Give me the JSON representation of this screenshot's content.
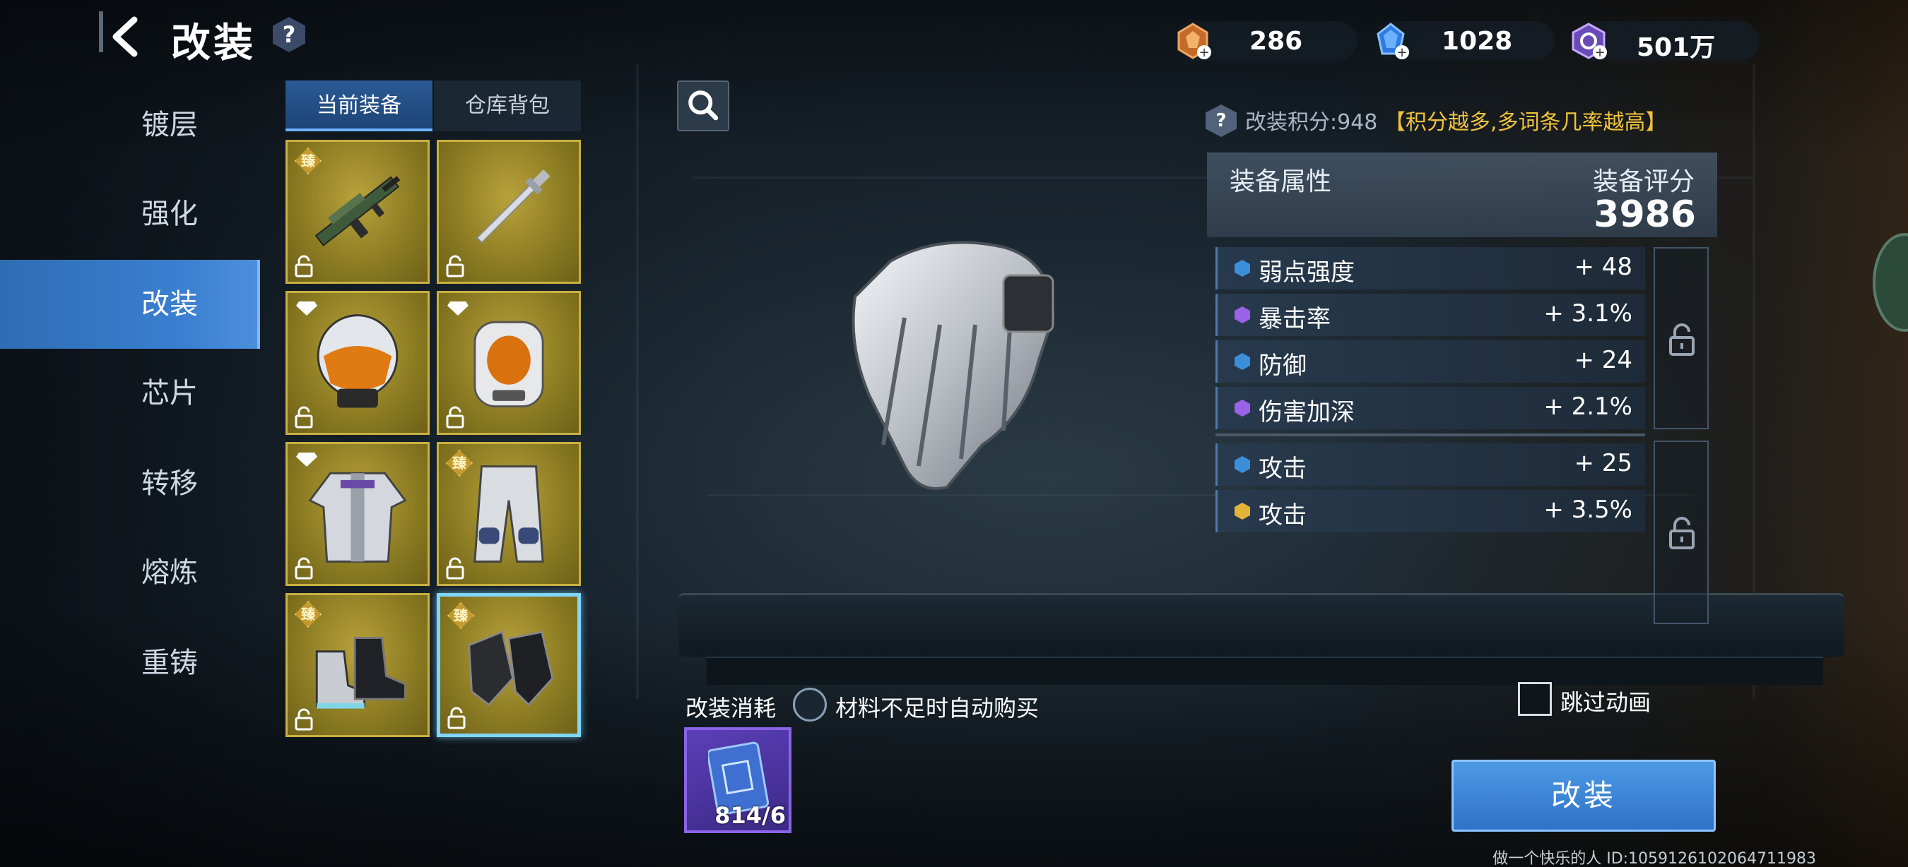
{
  "header": {
    "title": "改装",
    "help": "?"
  },
  "currencies": [
    {
      "name": "fuel",
      "value": "286",
      "color": "#d9823a"
    },
    {
      "name": "diamond",
      "value": "1028",
      "color": "#2f7be0"
    },
    {
      "name": "coin",
      "value": "501万",
      "color": "#8a5fd6"
    }
  ],
  "sidebar": {
    "items": [
      {
        "label": "镀层",
        "active": false
      },
      {
        "label": "强化",
        "active": false
      },
      {
        "label": "改装",
        "active": true
      },
      {
        "label": "芯片",
        "active": false
      },
      {
        "label": "转移",
        "active": false
      },
      {
        "label": "熔炼",
        "active": false
      },
      {
        "label": "重铸",
        "active": false
      }
    ]
  },
  "tabs": [
    {
      "label": "当前装备",
      "active": true
    },
    {
      "label": "仓库背包",
      "active": false
    }
  ],
  "equipment": [
    {
      "item": "rifle",
      "badge": "臻",
      "selected": false
    },
    {
      "item": "sword",
      "badge": "",
      "selected": false
    },
    {
      "item": "helmet",
      "badge": "gem",
      "selected": false
    },
    {
      "item": "backpack",
      "badge": "gem",
      "selected": false
    },
    {
      "item": "jacket",
      "badge": "gem",
      "selected": false
    },
    {
      "item": "pants",
      "badge": "臻",
      "selected": false
    },
    {
      "item": "boots",
      "badge": "臻",
      "selected": false
    },
    {
      "item": "gloves",
      "badge": "臻",
      "selected": true
    }
  ],
  "score": {
    "help": "?",
    "label": "改装积分:948",
    "hint": "【积分越多,多词条几率越高】"
  },
  "attributes": {
    "header_left": "装备属性",
    "header_right": "装备评分",
    "rating": "3986",
    "rows": [
      {
        "name": "弱点强度",
        "value": "+ 48",
        "tier": "blue"
      },
      {
        "name": "暴击率",
        "value": "+ 3.1%",
        "tier": "purple"
      },
      {
        "name": "防御",
        "value": "+ 24",
        "tier": "blue"
      },
      {
        "name": "伤害加深",
        "value": "+ 2.1%",
        "tier": "purple"
      },
      {
        "name": "攻击",
        "value": "+ 25",
        "tier": "blue"
      },
      {
        "name": "攻击",
        "value": "+ 3.5%",
        "tier": "gold"
      }
    ]
  },
  "tier_colors": {
    "blue": "#3b8fd9",
    "purple": "#9a62e6",
    "gold": "#e3b43a"
  },
  "bottom": {
    "cost_label": "改装消耗",
    "auto_buy_label": "材料不足时自动购买",
    "material_count": "814/6",
    "skip_label": "跳过动画",
    "modify_button": "改装",
    "user_id": "做一个快乐的人  ID:1059126102064711983"
  }
}
